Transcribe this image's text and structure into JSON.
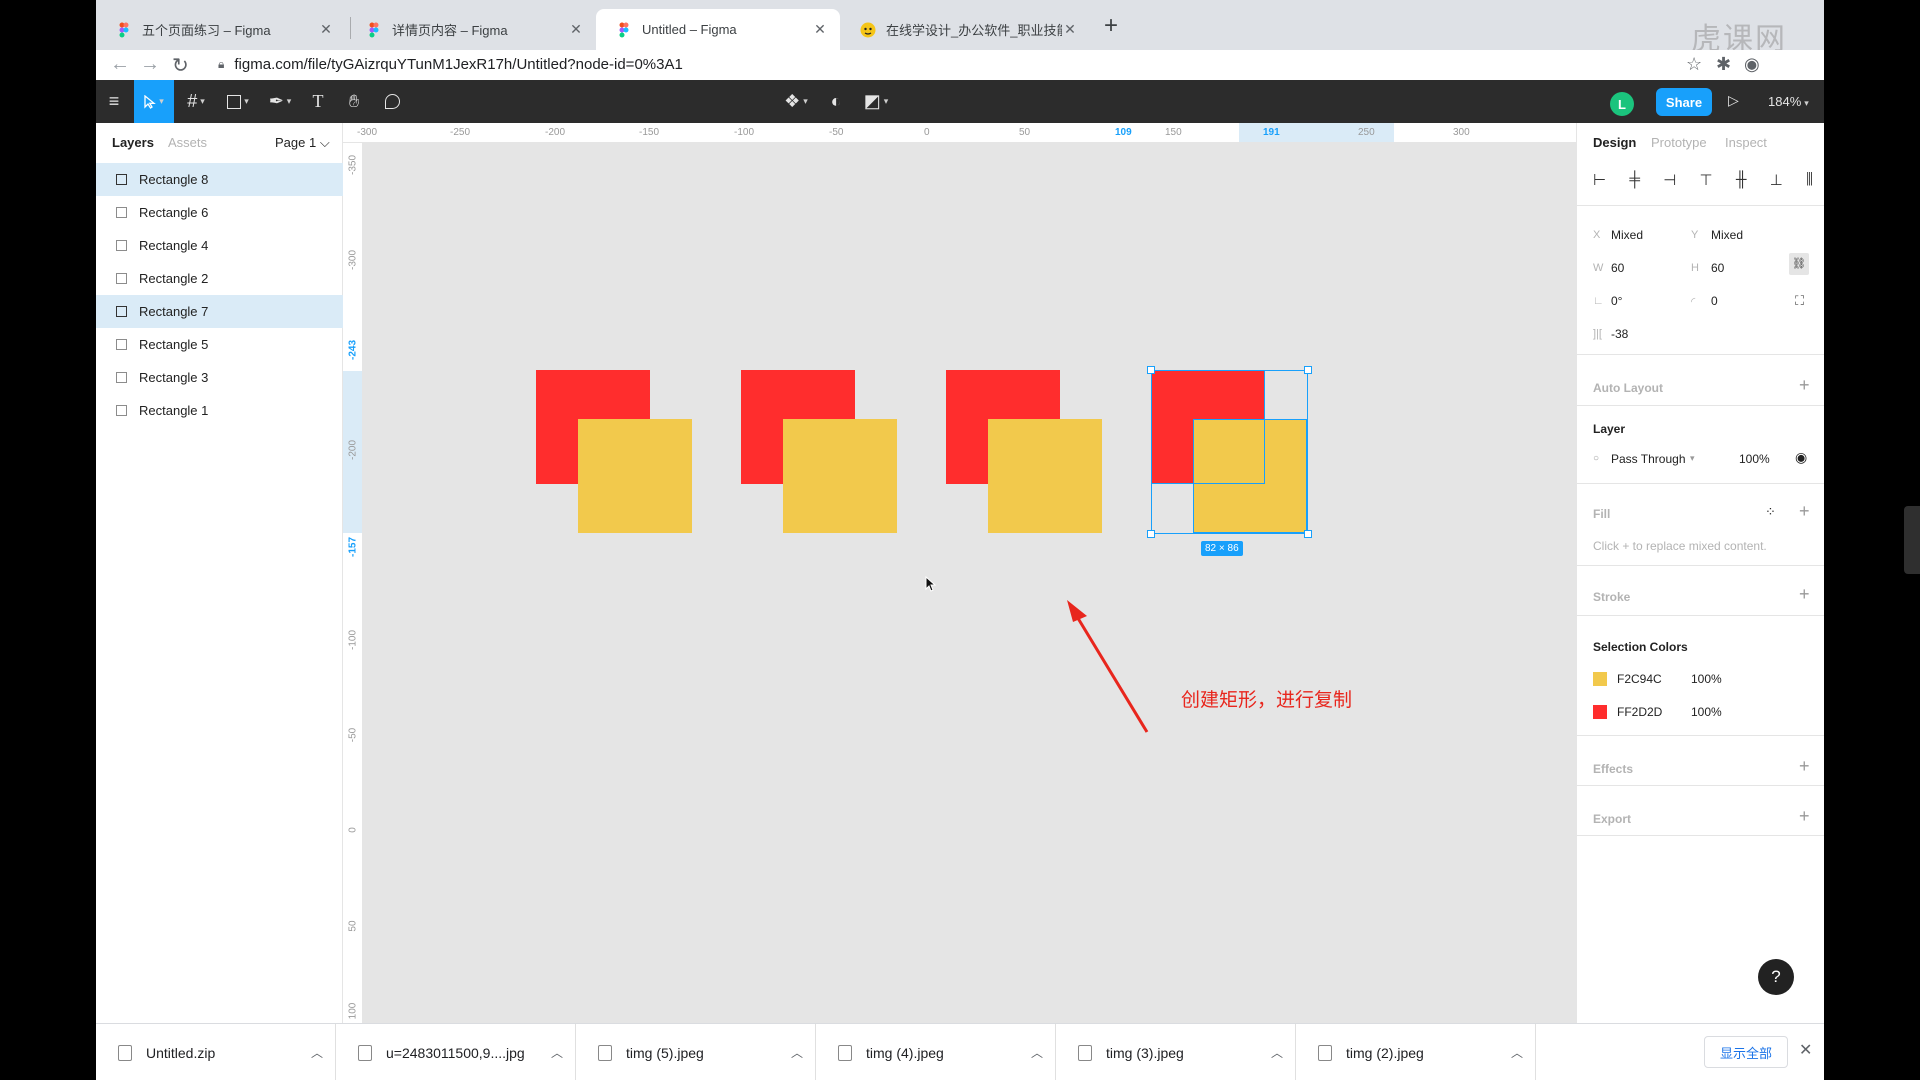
{
  "browser": {
    "tabs": [
      {
        "title": "五个页面练习 – Figma",
        "active": false
      },
      {
        "title": "详情页内容 – Figma",
        "active": false
      },
      {
        "title": "Untitled – Figma",
        "active": true
      },
      {
        "title": "在线学设计_办公软件_职业技能",
        "active": false
      }
    ],
    "url": "figma.com/file/tyGAizrquYTunM1JexR17h/Untitled?node-id=0%3A1"
  },
  "toolbar": {
    "avatar_initial": "L",
    "share_label": "Share",
    "zoom": "184%"
  },
  "layers_panel": {
    "tab_layers": "Layers",
    "tab_assets": "Assets",
    "page_label": "Page 1 ⌵",
    "layers": [
      {
        "name": "Rectangle 8",
        "selected": true
      },
      {
        "name": "Rectangle 6",
        "selected": false
      },
      {
        "name": "Rectangle 4",
        "selected": false
      },
      {
        "name": "Rectangle 2",
        "selected": false
      },
      {
        "name": "Rectangle 7",
        "selected": true
      },
      {
        "name": "Rectangle 5",
        "selected": false
      },
      {
        "name": "Rectangle 3",
        "selected": false
      },
      {
        "name": "Rectangle 1",
        "selected": false
      }
    ]
  },
  "rulers": {
    "horizontal": [
      "-300",
      "-250",
      "-200",
      "-150",
      "-100",
      "-50",
      "0",
      "50",
      "109",
      "150",
      "191",
      "250",
      "300"
    ],
    "horizontal_highlight": [
      "109",
      "191"
    ],
    "vertical": [
      "-350",
      "-300",
      "-243",
      "-200",
      "-157",
      "-100",
      "-50",
      "0",
      "50",
      "100"
    ],
    "vertical_highlight": [
      "-243",
      "-157"
    ]
  },
  "canvas": {
    "colors": {
      "red": "#FF2D2D",
      "yellow": "#F2C94C",
      "selection": "#18A0FB",
      "background": "#E5E5E5"
    },
    "selection_size_label": "82 × 86",
    "annotation": "创建矩形，进行复制"
  },
  "design_panel": {
    "tabs": [
      "Design",
      "Prototype",
      "Inspect"
    ],
    "x_label": "X",
    "x_value": "Mixed",
    "y_label": "Y",
    "y_value": "Mixed",
    "w_label": "W",
    "w_value": "60",
    "h_label": "H",
    "h_value": "60",
    "rotation": "0°",
    "radius": "0",
    "spacing": "-38",
    "auto_layout": "Auto Layout",
    "layer_title": "Layer",
    "blend_mode": "Pass Through",
    "opacity": "100%",
    "fill_title": "Fill",
    "fill_hint": "Click + to replace mixed content.",
    "stroke_title": "Stroke",
    "selection_colors_title": "Selection Colors",
    "selection_colors": [
      {
        "hex": "F2C94C",
        "swatch": "#F2C94C",
        "opacity": "100%"
      },
      {
        "hex": "FF2D2D",
        "swatch": "#FF2D2D",
        "opacity": "100%"
      }
    ],
    "effects_title": "Effects",
    "export_title": "Export"
  },
  "downloads": {
    "items": [
      "Untitled.zip",
      "u=2483011500,9....jpg",
      "timg (5).jpeg",
      "timg (4).jpeg",
      "timg (3).jpeg",
      "timg (2).jpeg"
    ],
    "show_all": "显示全部"
  },
  "icons": [
    "figma-icon",
    "search-icon",
    "star-icon",
    "extension-icon",
    "profile-icon",
    "menu-icon",
    "move-icon",
    "frame-icon",
    "rectangle-icon",
    "pen-icon",
    "text-icon",
    "hand-icon",
    "comment-icon",
    "component-icon",
    "mask-icon",
    "boolean-icon",
    "play-icon",
    "eye-icon",
    "help-icon"
  ]
}
